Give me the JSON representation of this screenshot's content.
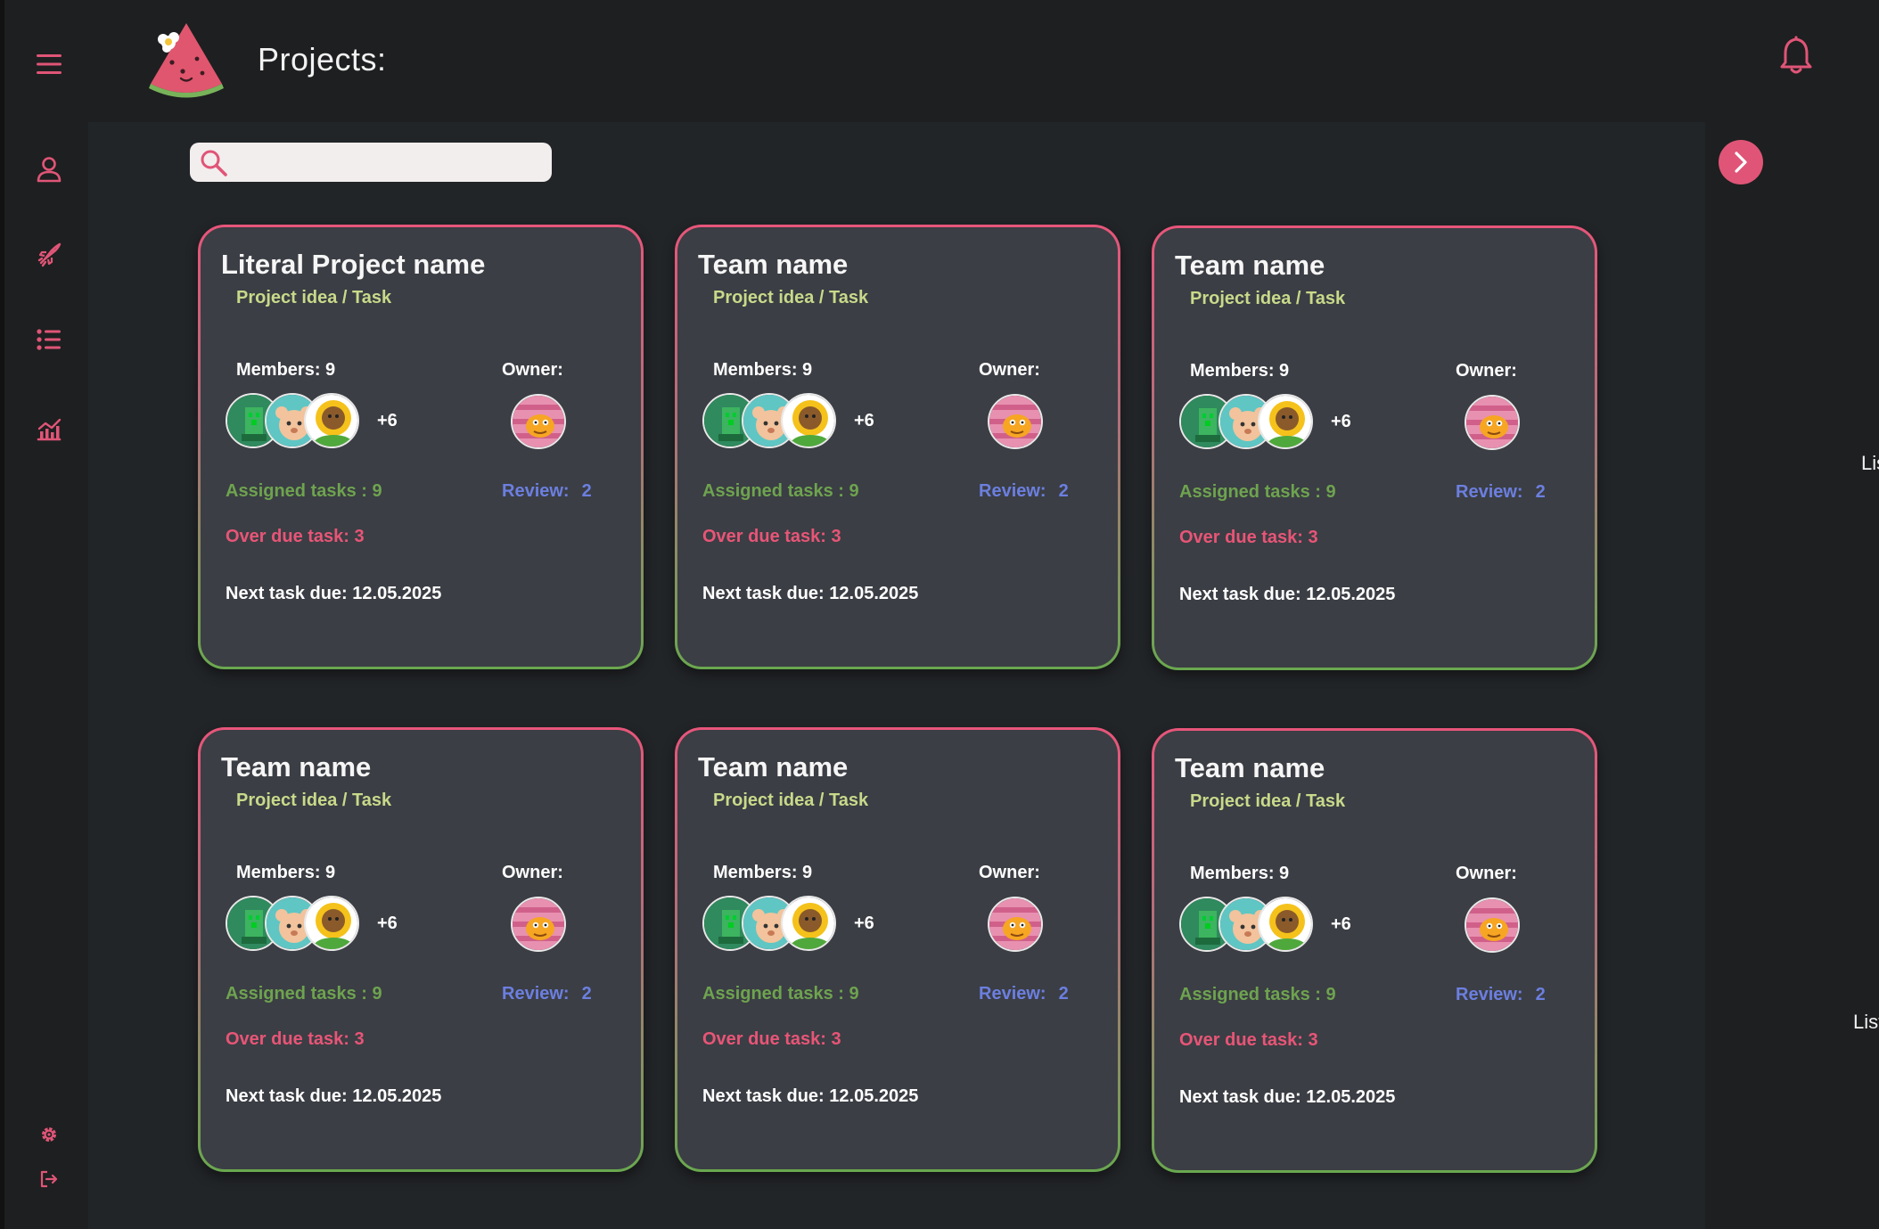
{
  "header": {
    "title": "Projects:",
    "menu_icon": "hamburger-menu-icon",
    "logo_icon": "watermelon-logo",
    "bell_icon": "bell-icon"
  },
  "sidebar": {
    "items": [
      {
        "icon": "user-icon"
      },
      {
        "icon": "rocket-icon"
      },
      {
        "icon": "list-icon"
      },
      {
        "icon": "chart-icon"
      }
    ],
    "bottom": [
      {
        "icon": "gear-icon"
      },
      {
        "icon": "logout-icon"
      }
    ]
  },
  "search": {
    "placeholder": "",
    "value": ""
  },
  "right_panel": {
    "arrow_icon": "chevron-right-icon",
    "list_labels": [
      "Lis",
      "List"
    ]
  },
  "colors": {
    "accent": "#e05577",
    "green": "#6ea34f",
    "review_blue": "#6c7fe0",
    "subtitle_yellow": "#c9d98a",
    "card_bg": "#3b3e44"
  },
  "cards": [
    {
      "title": "Literal Project name",
      "subtitle": "Project idea /  Task",
      "members_label": "Members: 9",
      "more_count": "+6",
      "owner_label": "Owner:",
      "assigned": "Assigned tasks : 9",
      "review_label": "Review:",
      "review_value": "2",
      "overdue": "Over due task: 3",
      "next_due": "Next task due: 12.05.2025"
    },
    {
      "title": "Team name",
      "subtitle": "Project idea /  Task",
      "members_label": "Members: 9",
      "more_count": "+6",
      "owner_label": "Owner:",
      "assigned": "Assigned tasks : 9",
      "review_label": "Review:",
      "review_value": "2",
      "overdue": "Over due task: 3",
      "next_due": "Next task due: 12.05.2025"
    },
    {
      "title": "Team name",
      "subtitle": "Project idea /  Task",
      "members_label": "Members: 9",
      "more_count": "+6",
      "owner_label": "Owner:",
      "assigned": "Assigned tasks : 9",
      "review_label": "Review:",
      "review_value": "2",
      "overdue": "Over due task: 3",
      "next_due": "Next task due: 12.05.2025"
    },
    {
      "title": "Team name",
      "subtitle": "Project idea /  Task",
      "members_label": "Members: 9",
      "more_count": "+6",
      "owner_label": "Owner:",
      "assigned": "Assigned tasks : 9",
      "review_label": "Review:",
      "review_value": "2",
      "overdue": "Over due task: 3",
      "next_due": "Next task due: 12.05.2025"
    },
    {
      "title": "Team name",
      "subtitle": "Project idea /  Task",
      "members_label": "Members: 9",
      "more_count": "+6",
      "owner_label": "Owner:",
      "assigned": "Assigned tasks : 9",
      "review_label": "Review:",
      "review_value": "2",
      "overdue": "Over due task: 3",
      "next_due": "Next task due: 12.05.2025"
    },
    {
      "title": "Team name",
      "subtitle": "Project idea /  Task",
      "members_label": "Members: 9",
      "more_count": "+6",
      "owner_label": "Owner:",
      "assigned": "Assigned tasks : 9",
      "review_label": "Review:",
      "review_value": "2",
      "overdue": "Over due task: 3",
      "next_due": "Next task due: 12.05.2025"
    }
  ]
}
